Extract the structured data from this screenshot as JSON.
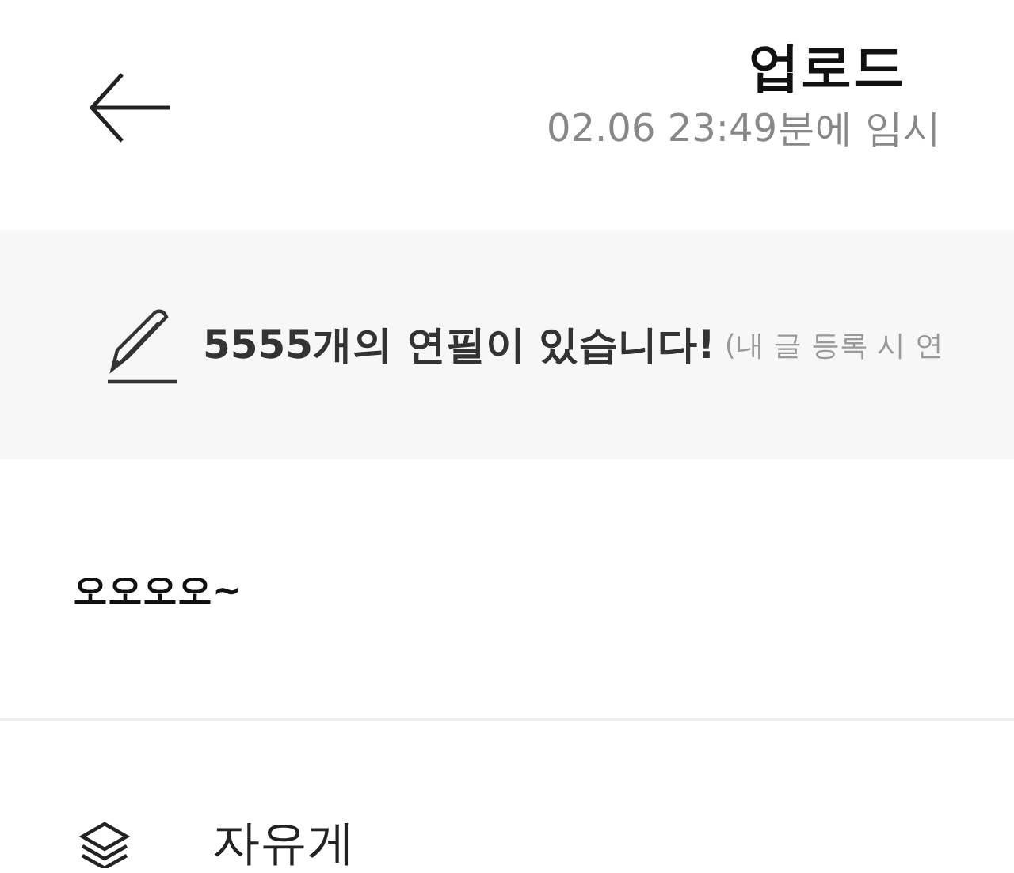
{
  "header": {
    "title": "업로드",
    "subtitle": "02.06 23:49분에 임시"
  },
  "banner": {
    "message": "5555개의 연필이 있습니다!",
    "note": "(내 글 등록 시 연"
  },
  "post": {
    "text": "오오오오~"
  },
  "category": {
    "label": "자유게"
  }
}
